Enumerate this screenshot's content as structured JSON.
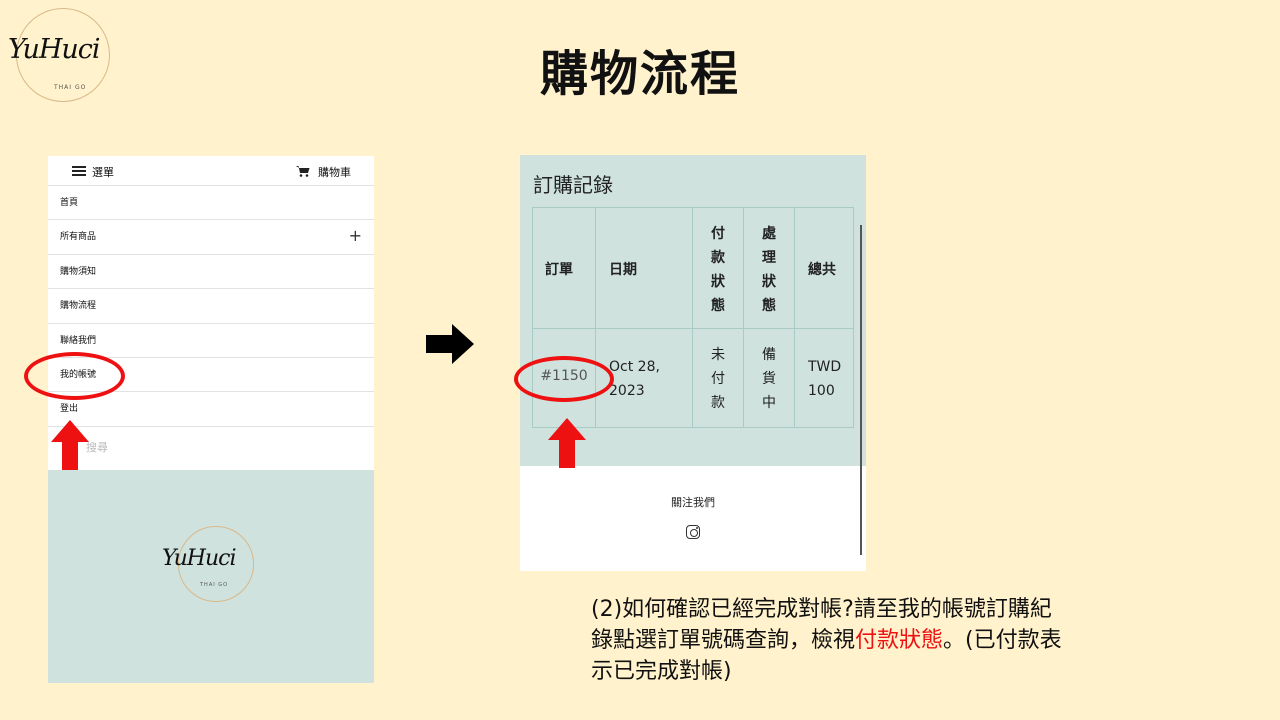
{
  "logo": {
    "script_text": "YuHuci",
    "sub_text": "THAI GO"
  },
  "slide_title": "購物流程",
  "left_menu": {
    "menu_label": "選單",
    "cart_label": "購物車",
    "items": [
      {
        "label": "首頁"
      },
      {
        "label": "所有商品",
        "has_plus": true
      },
      {
        "label": "購物須知"
      },
      {
        "label": "購物流程"
      },
      {
        "label": "聯絡我們"
      },
      {
        "label": "我的帳號"
      },
      {
        "label": "登出"
      }
    ],
    "search_label": "搜尋"
  },
  "order_history": {
    "title": "訂購記錄",
    "headers": [
      "訂單",
      "日期",
      "付\n款\n狀\n態",
      "處\n理\n狀\n態",
      "總共"
    ],
    "rows": [
      [
        "#1150",
        "Oct 28,\n2023",
        "未\n付\n款",
        "備\n貨\n中",
        "TWD\n100"
      ]
    ]
  },
  "footer": {
    "follow_label": "關注我們"
  },
  "caption": {
    "part1": "(2)如何確認已經完成對帳?請至我的帳號訂購紀錄點選訂單號碼查詢，檢視",
    "highlight": "付款狀態",
    "part2": "。(已付款表示已完成對帳)"
  },
  "colors": {
    "background": "#fff2cc",
    "teal": "#cfe2de",
    "highlight_red": "#ee1111"
  }
}
